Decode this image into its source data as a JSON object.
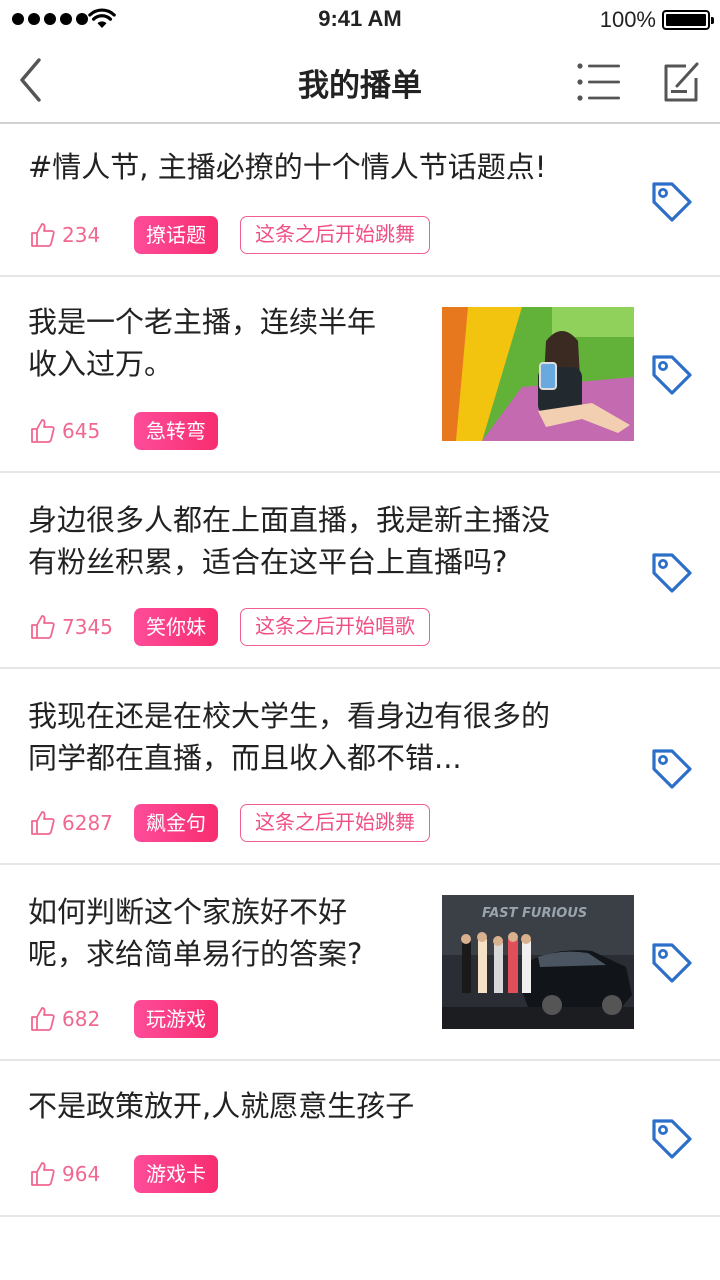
{
  "status_bar": {
    "time": "9:41 AM",
    "battery": "100%"
  },
  "nav": {
    "title": "我的播单"
  },
  "posts": [
    {
      "line1": "#情人节, 主播必撩的十个情人节话题点!",
      "line2": "",
      "likes": "234",
      "tag": "撩话题",
      "note": "这条之后开始跳舞"
    },
    {
      "line1": "我是一个老主播，连续半年",
      "line2": "收入过万。",
      "likes": "645",
      "tag": "急转弯",
      "note": ""
    },
    {
      "line1": "身边很多人都在上面直播，我是新主播没",
      "line2": "有粉丝积累，适合在这平台上直播吗?",
      "likes": "7345",
      "tag": "笑你妹",
      "note": "这条之后开始唱歌"
    },
    {
      "line1": "我现在还是在校大学生，看身边有很多的",
      "line2": "同学都在直播，而且收入都不错...",
      "likes": "6287",
      "tag": "飙金句",
      "note": "这条之后开始跳舞"
    },
    {
      "line1": "如何判断这个家族好不好",
      "line2": "呢，求给简单易行的答案?",
      "likes": "682",
      "tag": "玩游戏",
      "note": ""
    },
    {
      "line1": "不是政策放开,人就愿意生孩子",
      "line2": "",
      "likes": "964",
      "tag": "游戏卡",
      "note": ""
    }
  ],
  "photo_poster_text": "FAST FURIOUS",
  "colors": {
    "accent_pink": "#f72d6f",
    "tag_icon_blue": "#2c6fc9"
  }
}
